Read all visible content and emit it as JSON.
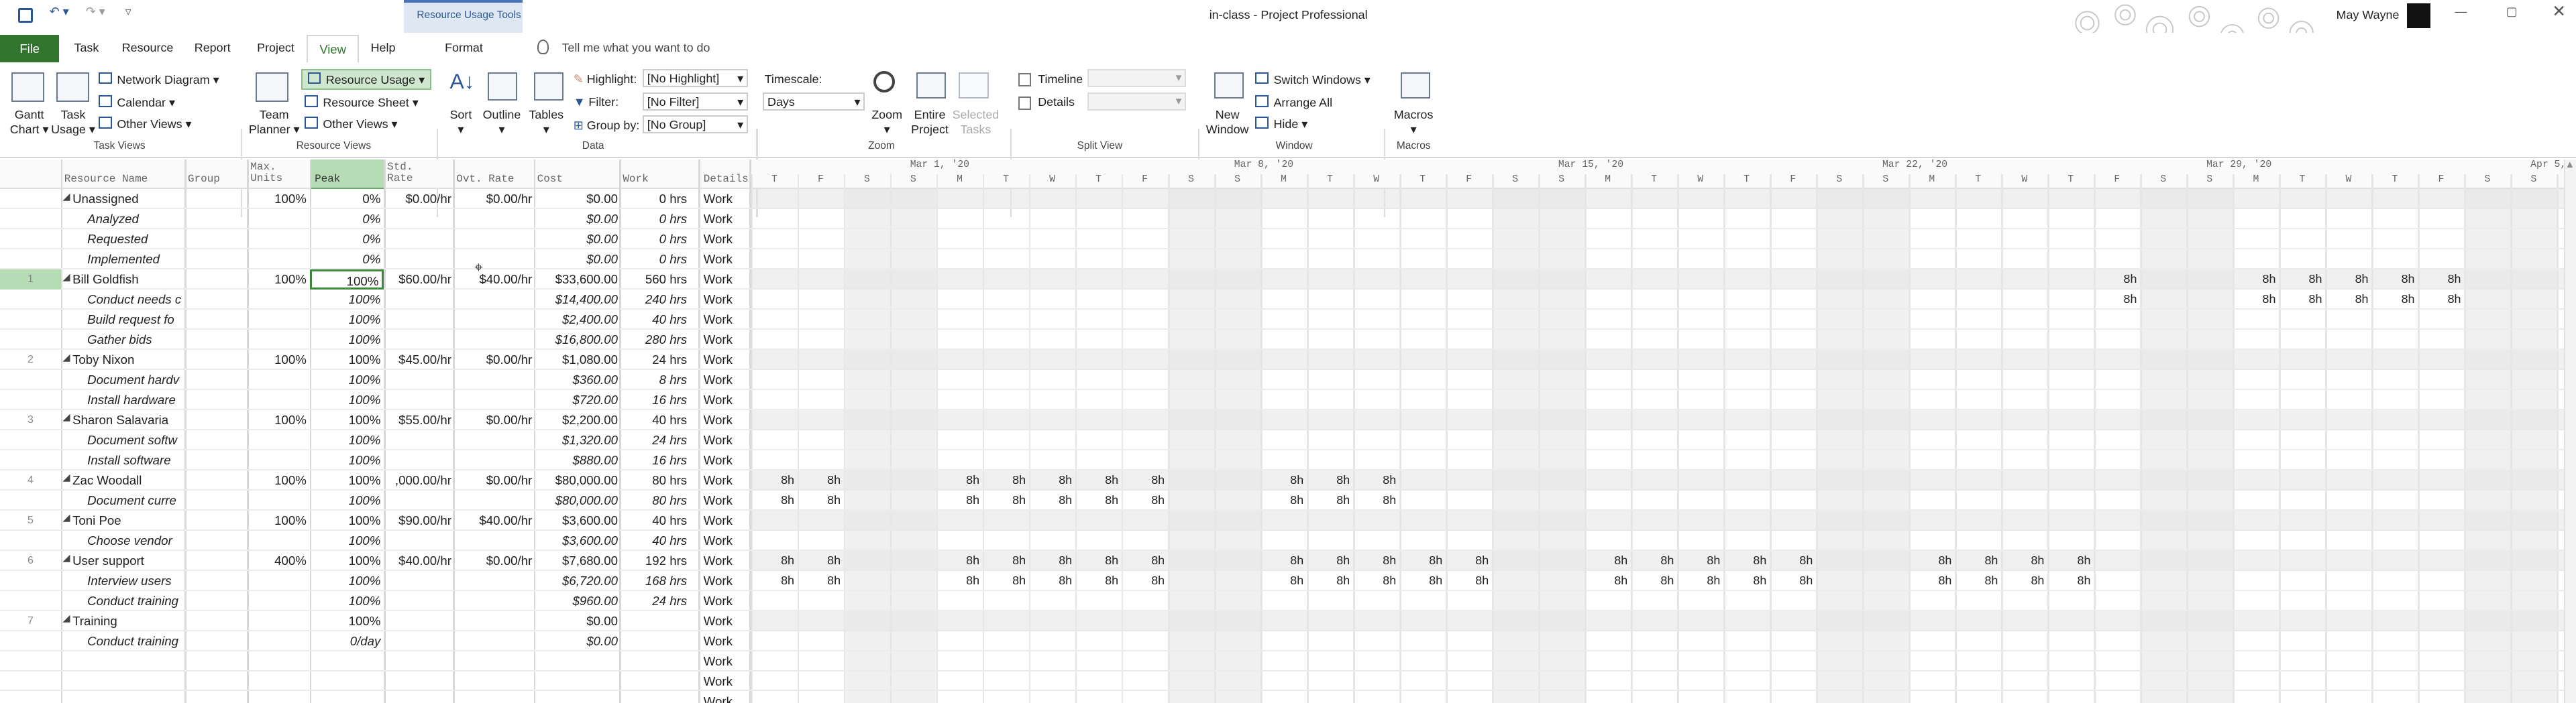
{
  "window": {
    "title": "in-class",
    "app": "Project Professional",
    "user": "May Wayne",
    "tools_label": "Resource Usage Tools"
  },
  "tabs": [
    {
      "label": "File"
    },
    {
      "label": "Task"
    },
    {
      "label": "Resource"
    },
    {
      "label": "Report"
    },
    {
      "label": "Project"
    },
    {
      "label": "View"
    },
    {
      "label": "Help"
    },
    {
      "label": "Format"
    }
  ],
  "tellme": "Tell me what you want to do",
  "ribbon": {
    "gantt": "Gantt",
    "chart": "Chart",
    "task": "Task",
    "usage": "Usage",
    "network": "Network Diagram",
    "calendar": "Calendar",
    "other_views": "Other Views",
    "team": "Team",
    "planner": "Planner",
    "resource_usage": "Resource Usage",
    "resource_sheet": "Resource Sheet",
    "other_views2": "Other Views",
    "sort": "Sort",
    "outline": "Outline",
    "tables": "Tables",
    "highlight": "Highlight:",
    "highlight_val": "[No Highlight]",
    "filter": "Filter:",
    "filter_val": "[No Filter]",
    "group": "Group by:",
    "group_val": "[No Group]",
    "timescale": "Timescale:",
    "timescale_val": "Days",
    "zoom": "Zoom",
    "entire": "Entire",
    "project": "Project",
    "selected": "Selected",
    "tasks": "Tasks",
    "timeline": "Timeline",
    "details": "Details",
    "new": "New",
    "window": "Window",
    "switch": "Switch Windows",
    "arrange": "Arrange All",
    "hide": "Hide",
    "macros": "Macros",
    "groups": [
      "Task Views",
      "Resource Views",
      "Data",
      "Zoom",
      "Split View",
      "Window",
      "Macros"
    ]
  },
  "columns": {
    "name": "Resource Name",
    "group": "Group",
    "max1": "Max.",
    "max2": "Units",
    "peak": "Peak",
    "std1": "Std.",
    "std2": "Rate",
    "ovt": "Ovt. Rate",
    "cost": "Cost",
    "work": "Work",
    "details": "Details"
  },
  "weeks": [
    "Mar 1, '20",
    "Mar 8, '20",
    "Mar 15, '20",
    "Mar 22, '20",
    "Mar 29, '20",
    "Apr 5, '2"
  ],
  "days": [
    "T",
    "F",
    "S",
    "S",
    "M",
    "T",
    "W",
    "T",
    "F",
    "S",
    "S",
    "M",
    "T",
    "W",
    "T",
    "F",
    "S",
    "S",
    "M",
    "T",
    "W",
    "T",
    "F",
    "S",
    "S",
    "M",
    "T",
    "W",
    "T",
    "F",
    "S",
    "S",
    "M",
    "T",
    "W",
    "T",
    "F",
    "S",
    "S",
    "M",
    "T"
  ],
  "rows": [
    {
      "id": "",
      "name": "Unassigned",
      "group": "",
      "max": "100%",
      "peak": "0%",
      "std": "$0.00/hr",
      "ovt": "$0.00/hr",
      "cost": "$0.00",
      "work": "0 hrs",
      "det": "Work",
      "res": true,
      "vals": []
    },
    {
      "id": "",
      "name": "Analyzed",
      "group": "",
      "max": "",
      "peak": "0%",
      "std": "",
      "ovt": "",
      "cost": "$0.00",
      "work": "0 hrs",
      "det": "Work",
      "res": false,
      "vals": []
    },
    {
      "id": "",
      "name": "Requested",
      "group": "",
      "max": "",
      "peak": "0%",
      "std": "",
      "ovt": "",
      "cost": "$0.00",
      "work": "0 hrs",
      "det": "Work",
      "res": false,
      "vals": []
    },
    {
      "id": "",
      "name": "Implemented",
      "group": "",
      "max": "",
      "peak": "0%",
      "std": "",
      "ovt": "",
      "cost": "$0.00",
      "work": "0 hrs",
      "det": "Work",
      "res": false,
      "vals": []
    },
    {
      "id": "1",
      "name": "Bill Goldfish",
      "group": "",
      "max": "100%",
      "peak": "100%",
      "std": "$60.00/hr",
      "ovt": "$40.00/hr",
      "cost": "$33,600.00",
      "work": "560 hrs",
      "det": "Work",
      "res": true,
      "vals": [
        [
          29,
          "8h"
        ],
        [
          32,
          "8h"
        ],
        [
          33,
          "8h"
        ],
        [
          34,
          "8h"
        ],
        [
          35,
          "8h"
        ],
        [
          36,
          "8h"
        ]
      ]
    },
    {
      "id": "",
      "name": "Conduct needs c",
      "group": "",
      "max": "",
      "peak": "100%",
      "std": "",
      "ovt": "",
      "cost": "$14,400.00",
      "work": "240 hrs",
      "det": "Work",
      "res": false,
      "vals": [
        [
          29,
          "8h"
        ],
        [
          32,
          "8h"
        ],
        [
          33,
          "8h"
        ],
        [
          34,
          "8h"
        ],
        [
          35,
          "8h"
        ],
        [
          36,
          "8h"
        ]
      ]
    },
    {
      "id": "",
      "name": "Build request fo",
      "group": "",
      "max": "",
      "peak": "100%",
      "std": "",
      "ovt": "",
      "cost": "$2,400.00",
      "work": "40 hrs",
      "det": "Work",
      "res": false,
      "vals": []
    },
    {
      "id": "",
      "name": "Gather bids",
      "group": "",
      "max": "",
      "peak": "100%",
      "std": "",
      "ovt": "",
      "cost": "$16,800.00",
      "work": "280 hrs",
      "det": "Work",
      "res": false,
      "vals": []
    },
    {
      "id": "2",
      "name": "Toby Nixon",
      "group": "",
      "max": "100%",
      "peak": "100%",
      "std": "$45.00/hr",
      "ovt": "$0.00/hr",
      "cost": "$1,080.00",
      "work": "24 hrs",
      "det": "Work",
      "res": true,
      "vals": []
    },
    {
      "id": "",
      "name": "Document hardv",
      "group": "",
      "max": "",
      "peak": "100%",
      "std": "",
      "ovt": "",
      "cost": "$360.00",
      "work": "8 hrs",
      "det": "Work",
      "res": false,
      "vals": []
    },
    {
      "id": "",
      "name": "Install hardware",
      "group": "",
      "max": "",
      "peak": "100%",
      "std": "",
      "ovt": "",
      "cost": "$720.00",
      "work": "16 hrs",
      "det": "Work",
      "res": false,
      "vals": []
    },
    {
      "id": "3",
      "name": "Sharon Salavaria",
      "group": "",
      "max": "100%",
      "peak": "100%",
      "std": "$55.00/hr",
      "ovt": "$0.00/hr",
      "cost": "$2,200.00",
      "work": "40 hrs",
      "det": "Work",
      "res": true,
      "vals": []
    },
    {
      "id": "",
      "name": "Document softw",
      "group": "",
      "max": "",
      "peak": "100%",
      "std": "",
      "ovt": "",
      "cost": "$1,320.00",
      "work": "24 hrs",
      "det": "Work",
      "res": false,
      "vals": []
    },
    {
      "id": "",
      "name": "Install software",
      "group": "",
      "max": "",
      "peak": "100%",
      "std": "",
      "ovt": "",
      "cost": "$880.00",
      "work": "16 hrs",
      "det": "Work",
      "res": false,
      "vals": []
    },
    {
      "id": "4",
      "name": "Zac Woodall",
      "group": "",
      "max": "100%",
      "peak": "100%",
      "std": ",000.00/hr",
      "ovt": "$0.00/hr",
      "cost": "$80,000.00",
      "work": "80 hrs",
      "det": "Work",
      "res": true,
      "vals": [
        [
          0,
          "8h"
        ],
        [
          1,
          "8h"
        ],
        [
          4,
          "8h"
        ],
        [
          5,
          "8h"
        ],
        [
          6,
          "8h"
        ],
        [
          7,
          "8h"
        ],
        [
          8,
          "8h"
        ],
        [
          11,
          "8h"
        ],
        [
          12,
          "8h"
        ],
        [
          13,
          "8h"
        ]
      ]
    },
    {
      "id": "",
      "name": "Document curre",
      "group": "",
      "max": "",
      "peak": "100%",
      "std": "",
      "ovt": "",
      "cost": "$80,000.00",
      "work": "80 hrs",
      "det": "Work",
      "res": false,
      "vals": [
        [
          0,
          "8h"
        ],
        [
          1,
          "8h"
        ],
        [
          4,
          "8h"
        ],
        [
          5,
          "8h"
        ],
        [
          6,
          "8h"
        ],
        [
          7,
          "8h"
        ],
        [
          8,
          "8h"
        ],
        [
          11,
          "8h"
        ],
        [
          12,
          "8h"
        ],
        [
          13,
          "8h"
        ]
      ]
    },
    {
      "id": "5",
      "name": "Toni Poe",
      "group": "",
      "max": "100%",
      "peak": "100%",
      "std": "$90.00/hr",
      "ovt": "$40.00/hr",
      "cost": "$3,600.00",
      "work": "40 hrs",
      "det": "Work",
      "res": true,
      "vals": []
    },
    {
      "id": "",
      "name": "Choose vendor",
      "group": "",
      "max": "",
      "peak": "100%",
      "std": "",
      "ovt": "",
      "cost": "$3,600.00",
      "work": "40 hrs",
      "det": "Work",
      "res": false,
      "vals": []
    },
    {
      "id": "6",
      "name": "User support",
      "group": "",
      "max": "400%",
      "peak": "100%",
      "std": "$40.00/hr",
      "ovt": "$0.00/hr",
      "cost": "$7,680.00",
      "work": "192 hrs",
      "det": "Work",
      "res": true,
      "vals": [
        [
          0,
          "8h"
        ],
        [
          1,
          "8h"
        ],
        [
          4,
          "8h"
        ],
        [
          5,
          "8h"
        ],
        [
          6,
          "8h"
        ],
        [
          7,
          "8h"
        ],
        [
          8,
          "8h"
        ],
        [
          11,
          "8h"
        ],
        [
          12,
          "8h"
        ],
        [
          13,
          "8h"
        ],
        [
          14,
          "8h"
        ],
        [
          15,
          "8h"
        ],
        [
          18,
          "8h"
        ],
        [
          19,
          "8h"
        ],
        [
          20,
          "8h"
        ],
        [
          21,
          "8h"
        ],
        [
          22,
          "8h"
        ],
        [
          25,
          "8h"
        ],
        [
          26,
          "8h"
        ],
        [
          27,
          "8h"
        ],
        [
          28,
          "8h"
        ]
      ]
    },
    {
      "id": "",
      "name": "Interview users",
      "group": "",
      "max": "",
      "peak": "100%",
      "std": "",
      "ovt": "",
      "cost": "$6,720.00",
      "work": "168 hrs",
      "det": "Work",
      "res": false,
      "vals": [
        [
          0,
          "8h"
        ],
        [
          1,
          "8h"
        ],
        [
          4,
          "8h"
        ],
        [
          5,
          "8h"
        ],
        [
          6,
          "8h"
        ],
        [
          7,
          "8h"
        ],
        [
          8,
          "8h"
        ],
        [
          11,
          "8h"
        ],
        [
          12,
          "8h"
        ],
        [
          13,
          "8h"
        ],
        [
          14,
          "8h"
        ],
        [
          15,
          "8h"
        ],
        [
          18,
          "8h"
        ],
        [
          19,
          "8h"
        ],
        [
          20,
          "8h"
        ],
        [
          21,
          "8h"
        ],
        [
          22,
          "8h"
        ],
        [
          25,
          "8h"
        ],
        [
          26,
          "8h"
        ],
        [
          27,
          "8h"
        ],
        [
          28,
          "8h"
        ]
      ]
    },
    {
      "id": "",
      "name": "Conduct training",
      "group": "",
      "max": "",
      "peak": "100%",
      "std": "",
      "ovt": "",
      "cost": "$960.00",
      "work": "24 hrs",
      "det": "Work",
      "res": false,
      "vals": []
    },
    {
      "id": "7",
      "name": "Training",
      "group": "",
      "max": "",
      "peak": "100%",
      "std": "",
      "ovt": "",
      "cost": "$0.00",
      "work": "",
      "det": "Work",
      "res": true,
      "vals": []
    },
    {
      "id": "",
      "name": "Conduct training",
      "group": "",
      "max": "",
      "peak": "0/day",
      "std": "",
      "ovt": "",
      "cost": "$0.00",
      "work": "",
      "det": "Work",
      "res": false,
      "vals": []
    },
    {
      "id": "",
      "name": "",
      "group": "",
      "max": "",
      "peak": "",
      "std": "",
      "ovt": "",
      "cost": "",
      "work": "",
      "det": "Work",
      "res": false,
      "vals": []
    },
    {
      "id": "",
      "name": "",
      "group": "",
      "max": "",
      "peak": "",
      "std": "",
      "ovt": "",
      "cost": "",
      "work": "",
      "det": "Work",
      "res": false,
      "vals": []
    },
    {
      "id": "",
      "name": "",
      "group": "",
      "max": "",
      "peak": "",
      "std": "",
      "ovt": "",
      "cost": "",
      "work": "",
      "det": "Work",
      "res": false,
      "vals": []
    }
  ]
}
